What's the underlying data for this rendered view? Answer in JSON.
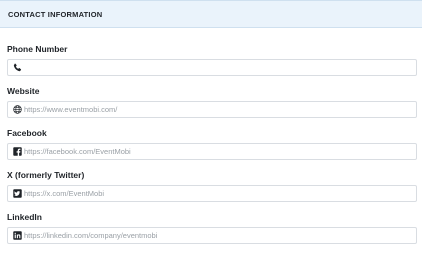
{
  "section": {
    "title": "CONTACT INFORMATION"
  },
  "fields": [
    {
      "label": "Phone Number",
      "icon": "phone-icon",
      "value": "",
      "placeholder": ""
    },
    {
      "label": "Website",
      "icon": "globe-icon",
      "value": "",
      "placeholder": "https://www.eventmobi.com/"
    },
    {
      "label": "Facebook",
      "icon": "facebook-icon",
      "value": "",
      "placeholder": "https://facebook.com/EventMobi"
    },
    {
      "label": "X (formerly Twitter)",
      "icon": "x-twitter-icon",
      "value": "",
      "placeholder": "https://x.com/EventMobi"
    },
    {
      "label": "LinkedIn",
      "icon": "linkedin-icon",
      "value": "",
      "placeholder": "https://linkedin.com/company/eventmobi"
    }
  ]
}
